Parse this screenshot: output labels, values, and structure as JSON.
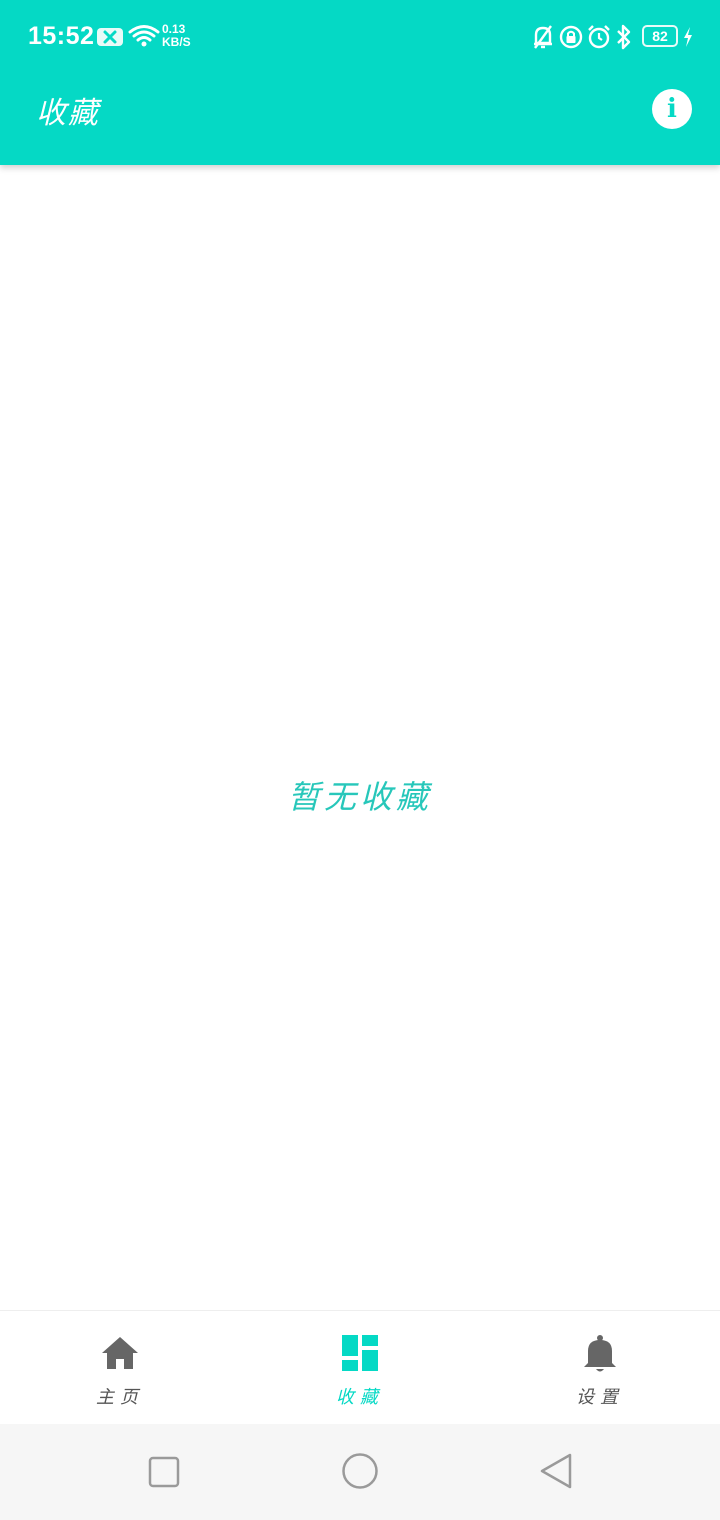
{
  "status_bar": {
    "time": "15:52",
    "net_speed_value": "0.13",
    "net_speed_unit": "KB/S",
    "battery_level": "82"
  },
  "app_bar": {
    "title": "收藏",
    "info_icon": "info-icon"
  },
  "content": {
    "empty_message": "暂无收藏"
  },
  "bottom_nav": {
    "items": [
      {
        "label": "主页",
        "icon": "home-icon",
        "selected": false
      },
      {
        "label": "收藏",
        "icon": "dashboard-icon",
        "selected": true
      },
      {
        "label": "设置",
        "icon": "bell-icon",
        "selected": false
      }
    ]
  },
  "colors": {
    "accent": "#05D9C5",
    "inactive": "#666666",
    "background": "#ffffff"
  }
}
